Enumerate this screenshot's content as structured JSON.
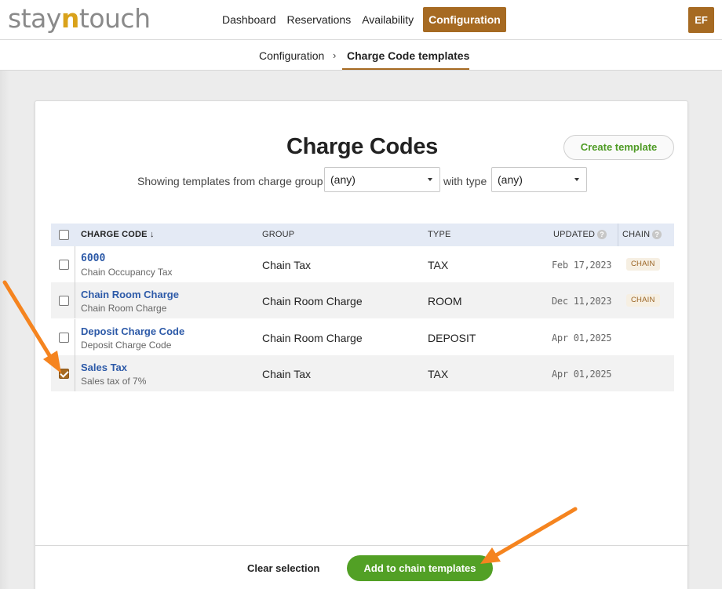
{
  "logo": {
    "part1": "stay",
    "part2": "n",
    "part3": "touch"
  },
  "nav": {
    "items": [
      {
        "label": "Dashboard"
      },
      {
        "label": "Reservations"
      },
      {
        "label": "Availability"
      },
      {
        "label": "Configuration"
      }
    ],
    "active": "Configuration"
  },
  "user": {
    "initials": "EF"
  },
  "breadcrumb": {
    "parent": "Configuration",
    "separator": "›",
    "current": "Charge Code templates"
  },
  "page": {
    "title": "Charge Codes",
    "create_button": "Create template",
    "filters": {
      "group_label": "Showing templates from charge group",
      "group_value": "(any)",
      "type_label": "with type",
      "type_value": "(any)"
    }
  },
  "table": {
    "headers": {
      "code": "CHARGE CODE ↓",
      "group": "GROUP",
      "type": "TYPE",
      "updated": "UPDATED",
      "chain": "CHAIN",
      "help": "?"
    },
    "rows": [
      {
        "code": "6000",
        "description": "Chain Occupancy Tax",
        "group": "Chain Tax",
        "type": "TAX",
        "updated": "Feb 17,2023",
        "chain": "CHAIN",
        "checked": false
      },
      {
        "code": "Chain Room Charge",
        "description": "Chain Room Charge",
        "group": "Chain Room Charge",
        "type": "ROOM",
        "updated": "Dec 11,2023",
        "chain": "CHAIN",
        "checked": false
      },
      {
        "code": "Deposit Charge Code",
        "description": "Deposit Charge Code",
        "group": "Chain Room Charge",
        "type": "DEPOSIT",
        "updated": "Apr 01,2025",
        "chain": "",
        "checked": false
      },
      {
        "code": "Sales Tax",
        "description": "Sales tax of 7%",
        "group": "Chain Tax",
        "type": "TAX",
        "updated": "Apr 01,2025",
        "chain": "",
        "checked": true
      }
    ]
  },
  "footer": {
    "clear_label": "Clear selection",
    "add_label": "Add to chain templates"
  },
  "colors": {
    "brand_brown": "#a66a22",
    "brand_green": "#52a025",
    "link_blue": "#2d5aa8",
    "annotation_arrow": "#f5841f"
  }
}
